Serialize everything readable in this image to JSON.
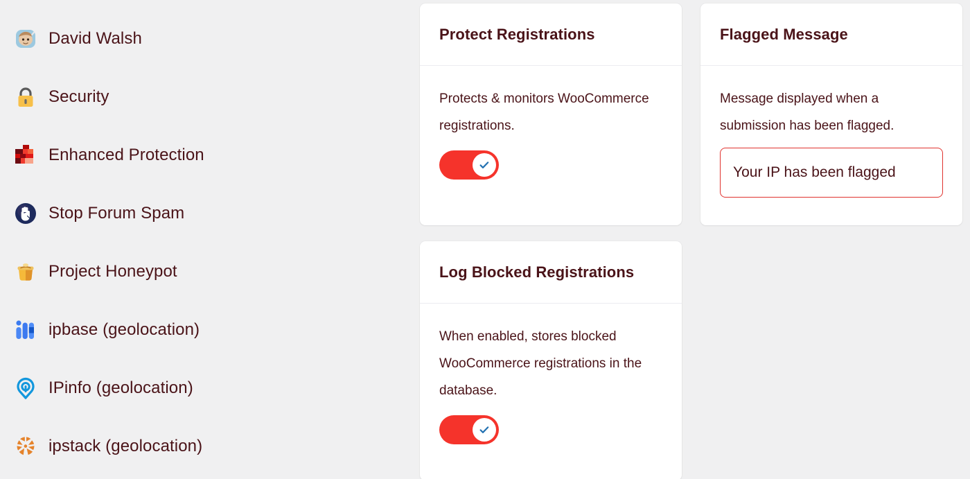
{
  "sidebar": {
    "items": [
      {
        "icon": "avatar-david-walsh-icon",
        "label": "David Walsh"
      },
      {
        "icon": "lock-icon",
        "label": "Security"
      },
      {
        "icon": "enhanced-protection-blocks-icon",
        "label": "Enhanced Protection"
      },
      {
        "icon": "stop-hand-icon",
        "label": "Stop Forum Spam"
      },
      {
        "icon": "honeypot-jar-icon",
        "label": "Project Honeypot"
      },
      {
        "icon": "ipbase-bars-icon",
        "label": "ipbase (geolocation)"
      },
      {
        "icon": "ipinfo-pin-icon",
        "label": "IPinfo (geolocation)"
      },
      {
        "icon": "ipstack-globe-icon",
        "label": "ipstack (geolocation)"
      }
    ]
  },
  "cards": {
    "protect_registrations": {
      "title": "Protect Registrations",
      "description": "Protects & monitors WooCommerce registrations.",
      "toggle": {
        "state": "on",
        "icon": "check-icon"
      }
    },
    "flagged_message": {
      "title": "Flagged Message",
      "description": "Message displayed when a submission has been flagged.",
      "input": {
        "value": "Your IP has been flagged",
        "placeholder": "Your IP has been flagged"
      }
    },
    "log_blocked_registrations": {
      "title": "Log Blocked Registrations",
      "description": "When enabled, stores blocked WooCommerce registrations in the database.",
      "toggle": {
        "state": "on",
        "icon": "check-icon"
      }
    }
  },
  "colors": {
    "page_background": "#f0f0f1",
    "card_background": "#ffffff",
    "text": "#4a1318",
    "toggle_on": "#f5332b",
    "check": "#2271b1",
    "input_border": "#e0322e",
    "divider": "#ececf1"
  }
}
